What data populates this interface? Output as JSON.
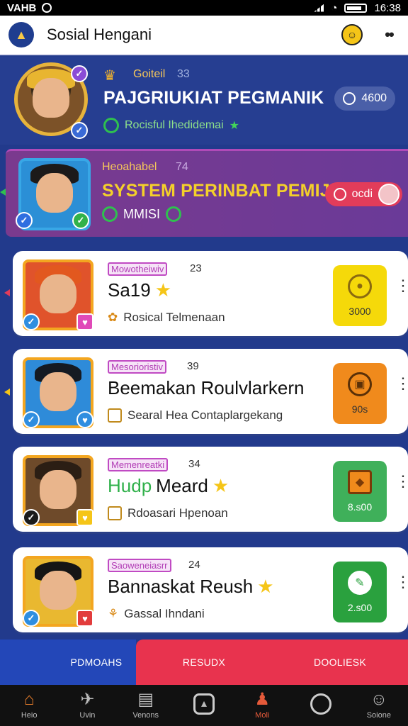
{
  "status": {
    "carrier": "VAHB",
    "time": "16:38"
  },
  "appbar": {
    "title": "Sosial Hengani",
    "icons": [
      "app-logo",
      "bell-icon",
      "more-icon"
    ]
  },
  "featured": [
    {
      "tag": "Goiteil",
      "count": "33",
      "title": "PAJGRIUKIAT PEGMANIK",
      "subtitle": "Rocisful Ihedidemai",
      "chip": "4600",
      "chip_color": "#4a5fa8"
    },
    {
      "tag": "Heoahabel",
      "count": "74",
      "title": "SYSTEM PERINBAT PEMIJAN",
      "subtitle": "MMISI",
      "chip": "ocdi",
      "chip_color": "#e23c5a"
    }
  ],
  "cards": [
    {
      "tag": "Mowotheiwiv",
      "count": "23",
      "title": "Sa19",
      "star": true,
      "subtitle": "Rosical Telmenaan",
      "action_value": "3000",
      "action_color": "#f5d90a"
    },
    {
      "tag": "Mesorioristiv",
      "count": "39",
      "title": "Beemakan Roulvlarkern",
      "star": false,
      "subtitle": "Searal Hea Contaplargekang",
      "action_value": "90s",
      "action_color": "#f08a1c"
    },
    {
      "tag": "Memenreatki",
      "count": "34",
      "title_green": "Hudp",
      "title": "Meard",
      "star": true,
      "subtitle": "Rdoasari Hpenoan",
      "action_value": "8.s00",
      "action_color": "#3fb05a"
    },
    {
      "tag": "Saoweneiasrr",
      "count": "24",
      "title": "Bannaskat Reush",
      "star": true,
      "subtitle": "Gassal Ihndani",
      "action_value": "2.s00",
      "action_color": "#2aa13e"
    }
  ],
  "segments": [
    {
      "label": "PDMOAHS",
      "color": "#2347b8"
    },
    {
      "label": "RESUDX",
      "color": "#e8334e"
    },
    {
      "label": "DOOLIESK",
      "color": "#e8334e"
    }
  ],
  "tabs": [
    {
      "label": "Heio",
      "icon": "home-icon",
      "active": false
    },
    {
      "label": "Uvin",
      "icon": "plane-icon",
      "active": false
    },
    {
      "label": "Venons",
      "icon": "document-icon",
      "active": false
    },
    {
      "label": "",
      "icon": "clock-icon",
      "active": false
    },
    {
      "label": "Moli",
      "icon": "chess-piece-icon",
      "active": true
    },
    {
      "label": "",
      "icon": "timer-icon",
      "active": false
    },
    {
      "label": "Soione",
      "icon": "profile-icon",
      "active": false
    }
  ]
}
